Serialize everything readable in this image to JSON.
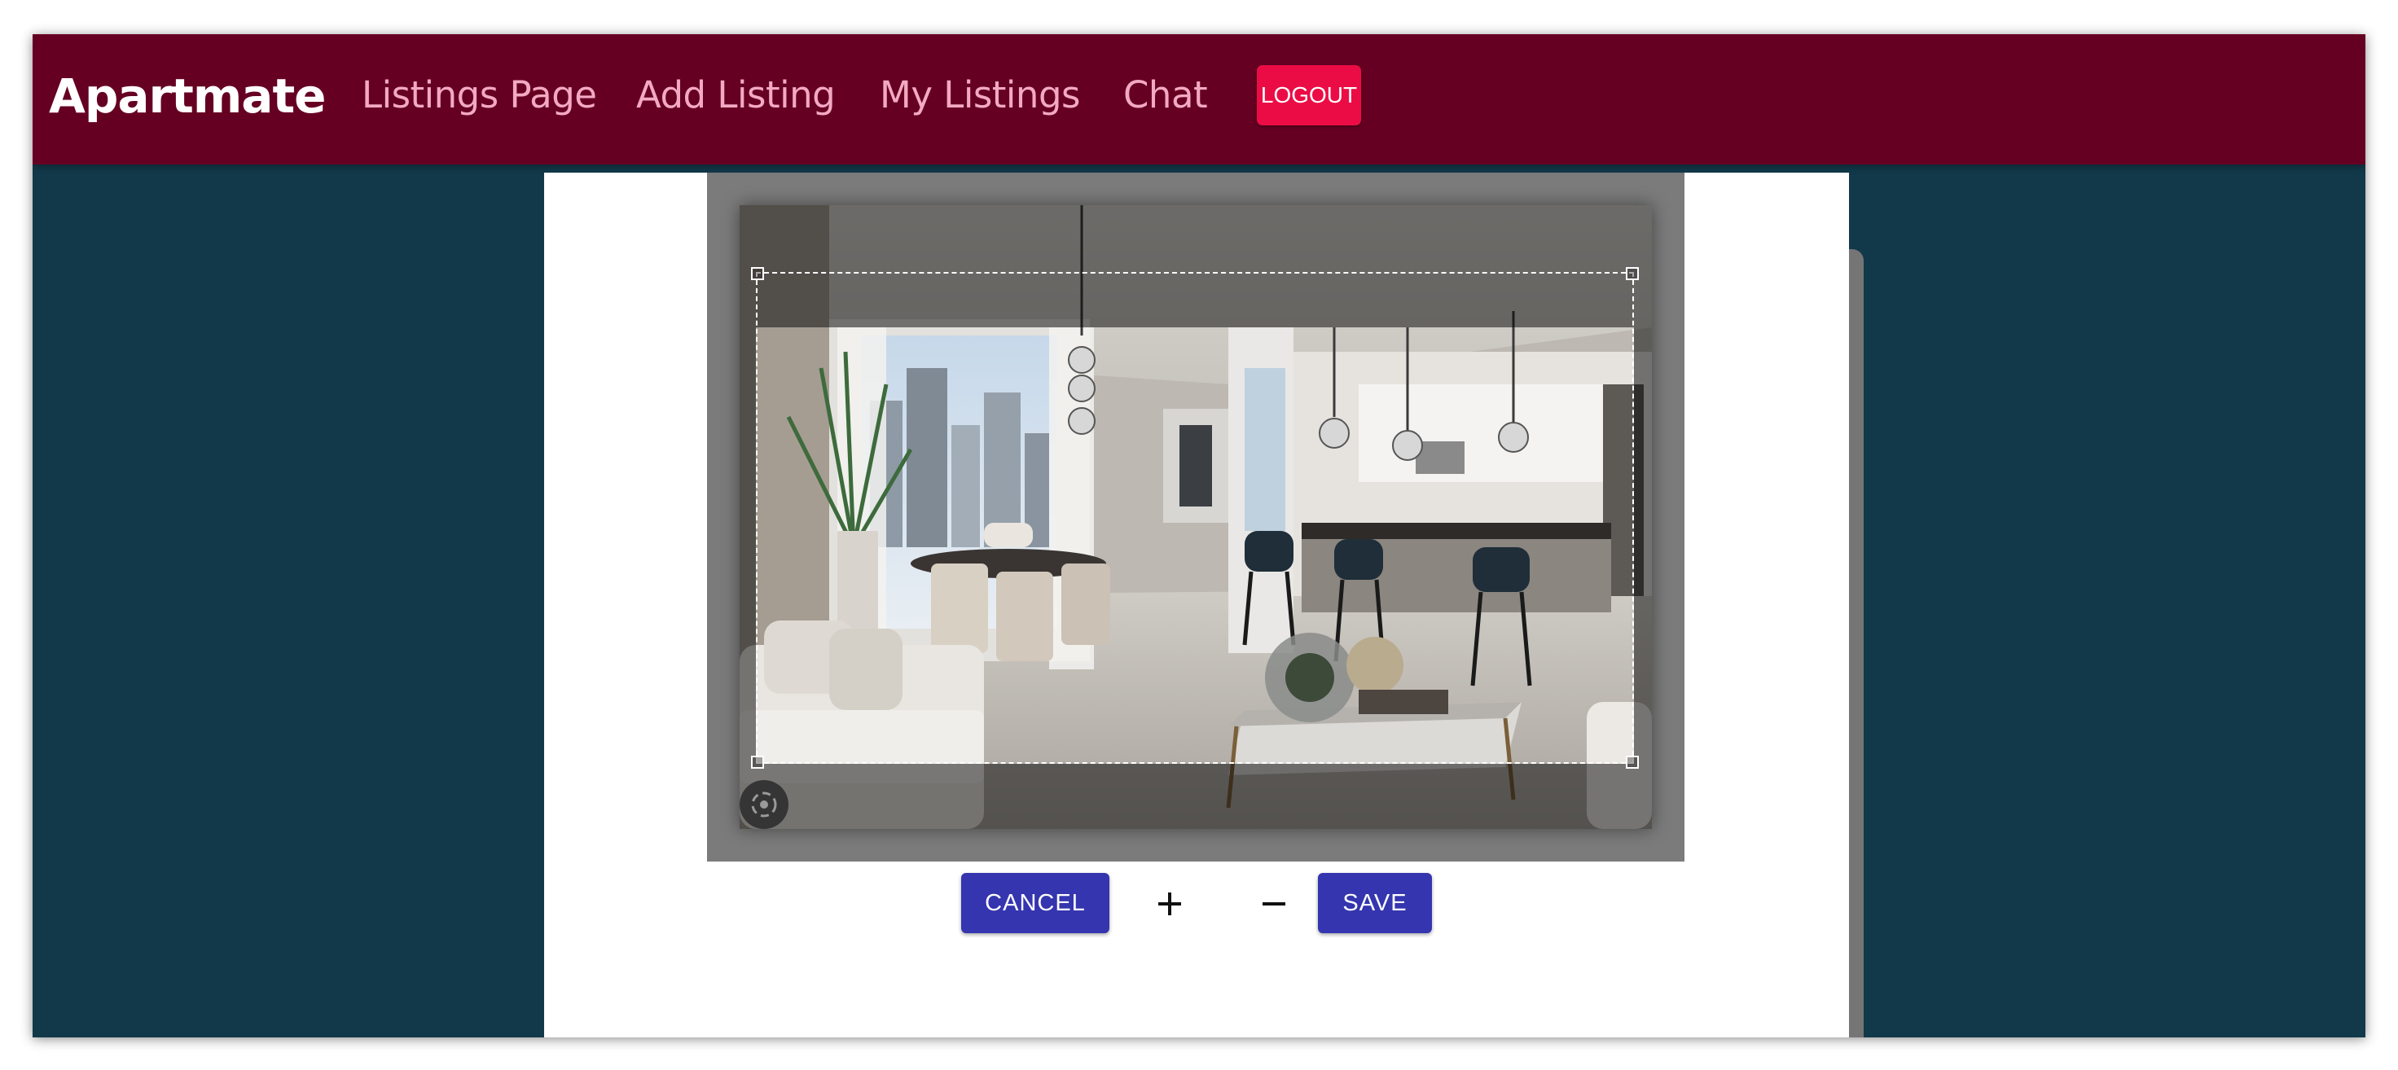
{
  "navbar": {
    "brand": "Apartmate",
    "links": [
      "Listings Page",
      "Add Listing",
      "My Listings",
      "Chat"
    ],
    "logout_label": "LOGOUT",
    "background_color": "#660022",
    "link_color": "#f3a9c3",
    "logout_color": "#ec0c45"
  },
  "page": {
    "background_color": "#12394a"
  },
  "cropper": {
    "image_alt": "Modern apartment living room with dining table and kitchen bar",
    "cancel_label": "CANCEL",
    "save_label": "SAVE",
    "zoom_in_icon": "plus-icon",
    "zoom_out_icon": "minus-icon",
    "rotate_icon": "rotate-icon",
    "button_color": "#3535af"
  }
}
